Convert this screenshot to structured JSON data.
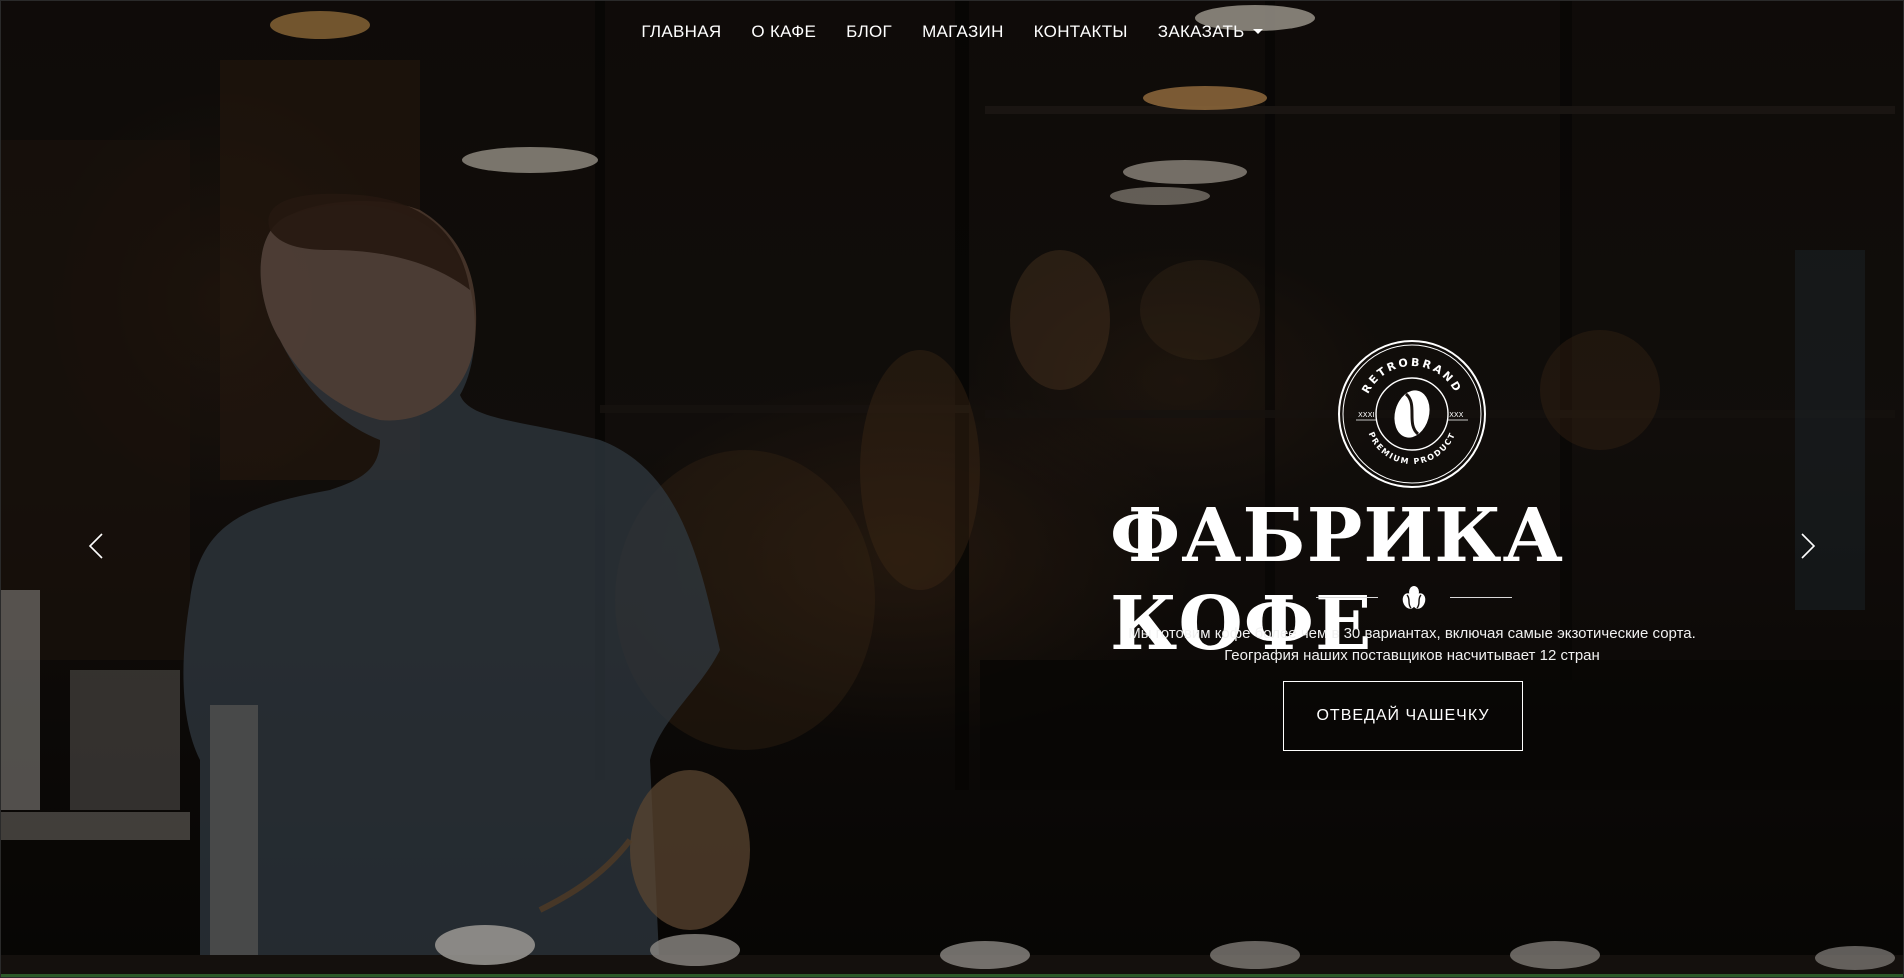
{
  "nav": {
    "items": [
      {
        "label": "ГЛАВНАЯ"
      },
      {
        "label": "О КАФЕ"
      },
      {
        "label": "БЛОГ"
      },
      {
        "label": "МАГАЗИН"
      },
      {
        "label": "КОНТАКТЫ"
      },
      {
        "label": "ЗАКАЗАТЬ",
        "has_dropdown": true
      }
    ]
  },
  "carousel": {
    "prev_icon": "chevron-left-icon",
    "next_icon": "chevron-right-icon"
  },
  "logo": {
    "top_text": "RETROBRAND",
    "bottom_text": "PREMIUM PRODUCT",
    "left_text": "XXXI",
    "right_text": "IXXX",
    "icon": "coffee-bean-icon"
  },
  "hero": {
    "title": "ФАБРИКА КОФЕ",
    "divider_icon": "coffee-beans-icon",
    "subtitle_line1": "Мы готовим кофе более чем в 30 вариантах, включая самые экзотические сорта.",
    "subtitle_line2": "География наших поставщиков насчитывает 12 стран",
    "cta_label": "ОТВЕДАЙ ЧАШЕЧКУ"
  },
  "colors": {
    "text": "#ffffff",
    "background": "#15110e",
    "bottom_strip": "#2d5a2a"
  }
}
